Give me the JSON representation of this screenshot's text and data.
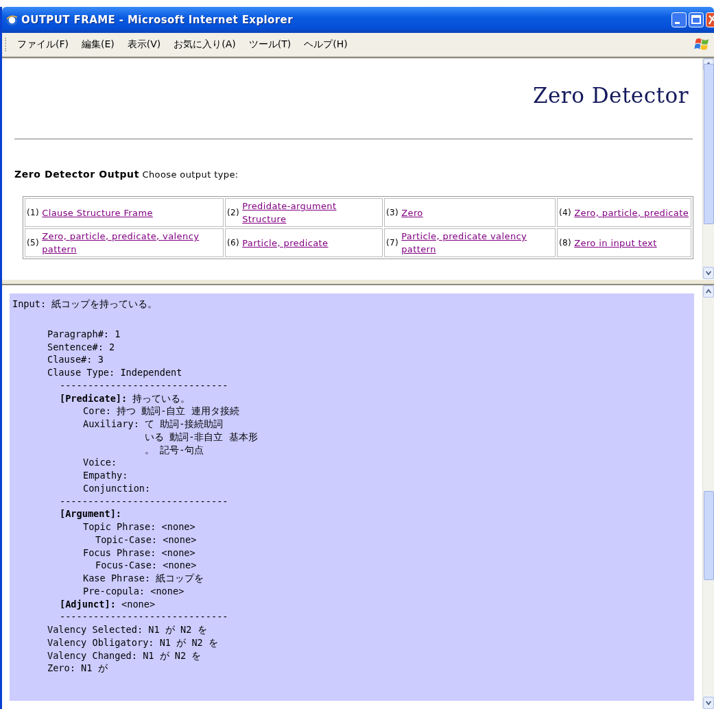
{
  "window": {
    "title": "OUTPUT FRAME - Microsoft Internet Explorer"
  },
  "menu": [
    "ファイル(F)",
    "編集(E)",
    "表示(V)",
    "お気に入り(A)",
    "ツール(T)",
    "ヘルプ(H)"
  ],
  "top_frame": {
    "logo": "Zero Detector",
    "heading": "Zero Detector Output",
    "prompt": "Choose output type:",
    "options": [
      {
        "number": "(1)",
        "link": "Clause Structure Frame"
      },
      {
        "number": "(2)",
        "link": "Predidate-argument Structure"
      },
      {
        "number": "(3)",
        "link": "Zero"
      },
      {
        "number": "(4)",
        "link": "Zero, particle, predicate"
      },
      {
        "number": "(5)",
        "link": "Zero, particle, predicate, valency pattern"
      },
      {
        "number": "(6)",
        "link": "Particle, predicate"
      },
      {
        "number": "(7)",
        "link": "Particle, predicate valency pattern"
      },
      {
        "number": "(8)",
        "link": "Zero in input text"
      }
    ]
  },
  "bottom_frame": {
    "input": "Input: 紙コップを持っている。",
    "lines": [
      {
        "kind": "field",
        "label": "Paragraph#:",
        "value": "1"
      },
      {
        "kind": "field",
        "label": "Sentence#:",
        "value": "2"
      },
      {
        "kind": "field",
        "label": "Clause#:",
        "value": "3"
      },
      {
        "kind": "field",
        "label": "Clause Type:",
        "value": "Independent",
        "children": [
          {
            "kind": "rule",
            "text": "------------------------------"
          },
          {
            "kind": "section",
            "label": "[Predicate]:",
            "value": "持っている。",
            "children": [
              {
                "kind": "field",
                "label": "Core:",
                "value": "持つ 動詞-自立 連用タ接続"
              },
              {
                "kind": "field",
                "label": "Auxiliary:",
                "value": "て 助詞-接続助詞",
                "continuation": [
                  "いる 動詞-非自立 基本形",
                  "。 記号-句点"
                ]
              },
              {
                "kind": "field",
                "label": "Voice:"
              },
              {
                "kind": "field",
                "label": "Empathy:"
              },
              {
                "kind": "field",
                "label": "Conjunction:"
              }
            ]
          },
          {
            "kind": "rule",
            "text": "------------------------------"
          },
          {
            "kind": "section",
            "label": "[Argument]:",
            "children": [
              {
                "kind": "field",
                "label": "Topic Phrase:",
                "value": "<none>",
                "children": [
                  {
                    "kind": "field",
                    "label": "Topic-Case:",
                    "value": "<none>"
                  }
                ]
              },
              {
                "kind": "field",
                "label": "Focus Phrase:",
                "value": "<none>",
                "children": [
                  {
                    "kind": "field",
                    "label": "Focus-Case:",
                    "value": "<none>"
                  }
                ]
              },
              {
                "kind": "field",
                "label": "Kase Phrase:",
                "value": "紙コップを"
              },
              {
                "kind": "field",
                "label": "Pre-copula:",
                "value": "<none>"
              }
            ]
          },
          {
            "kind": "section",
            "label": "[Adjunct]:",
            "value": "<none>"
          },
          {
            "kind": "rule",
            "text": "------------------------------"
          }
        ]
      },
      {
        "kind": "field",
        "label": "Valency Selected:",
        "value": "N1 が N2 を"
      },
      {
        "kind": "field",
        "label": "Valency Obligatory:",
        "value": "N1 が N2 を"
      },
      {
        "kind": "field",
        "label": "Valency Changed:",
        "value": "N1 が N2 を"
      },
      {
        "kind": "field",
        "label": "Zero:",
        "value": "N1 が"
      }
    ]
  }
}
